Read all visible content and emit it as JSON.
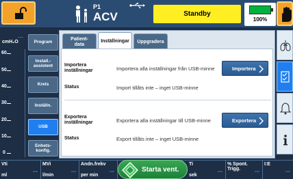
{
  "topbar": {
    "patient_mode_label": "P1",
    "patient_mode": "ACV",
    "status": "Standby",
    "battery_percent_label": "100%",
    "battery_level": 1.0
  },
  "gauge": {
    "unit": "cmH₂O",
    "value": "---",
    "ticks": [
      "60",
      "50",
      "40",
      "30",
      "20",
      "10",
      "0"
    ]
  },
  "menu": {
    "items": [
      {
        "label": "Program"
      },
      {
        "label": "Install.-\nassistent"
      },
      {
        "label": "Krets"
      },
      {
        "label": "Inställn."
      },
      {
        "label": "USB"
      },
      {
        "label": "Enhets-\nkonfig."
      }
    ],
    "active": "USB"
  },
  "tabs": [
    {
      "label": "Patient-\ndata"
    },
    {
      "label": "Inställningar"
    },
    {
      "label": "Uppgradera"
    }
  ],
  "panel": {
    "import": {
      "label": "Importera\ninställningar",
      "description": "Importera alla inställningar från USB-minne",
      "button": "Importera",
      "status_label": "Status",
      "status_text": "Import tillåts inte – inget USB-minne"
    },
    "export": {
      "label": "Exportera\ninställningar",
      "description": "Exportera alla inställningar till USB-minne",
      "button": "Exportera",
      "status_label": "Status",
      "status_text": "Export tillåts inte – inget USB-minne"
    }
  },
  "bottom": {
    "cells": [
      {
        "name": "Vti",
        "unit": "ml",
        "value": "---"
      },
      {
        "name": "MVi",
        "unit": "l/min",
        "value": "---"
      },
      {
        "name": "Andn.frekv",
        "unit": "per min",
        "value": "---"
      },
      {
        "name": "Ti",
        "unit": "sek",
        "value": "---"
      },
      {
        "name": "% Spont.\nTrigg.",
        "unit": "",
        "value": "---"
      },
      {
        "name": "I:E",
        "unit": "",
        "value": "---"
      }
    ],
    "start_button": "Starta vent."
  },
  "icons": {
    "lock": "lock-open-icon",
    "patient": "patient-icon",
    "usb": "usb-icon",
    "alarm_silence": "alarm-hand-icon",
    "lungs": "lungs-icon",
    "checklist": "checklist-icon",
    "bell": "bell-icon",
    "info": "info-icon",
    "start": "start-diamond-icon"
  },
  "colors": {
    "accent_blue": "#1f7ff0",
    "standby_yellow": "#ffee22",
    "lock_orange": "#f2a22a",
    "start_green": "#2e9a4a"
  }
}
